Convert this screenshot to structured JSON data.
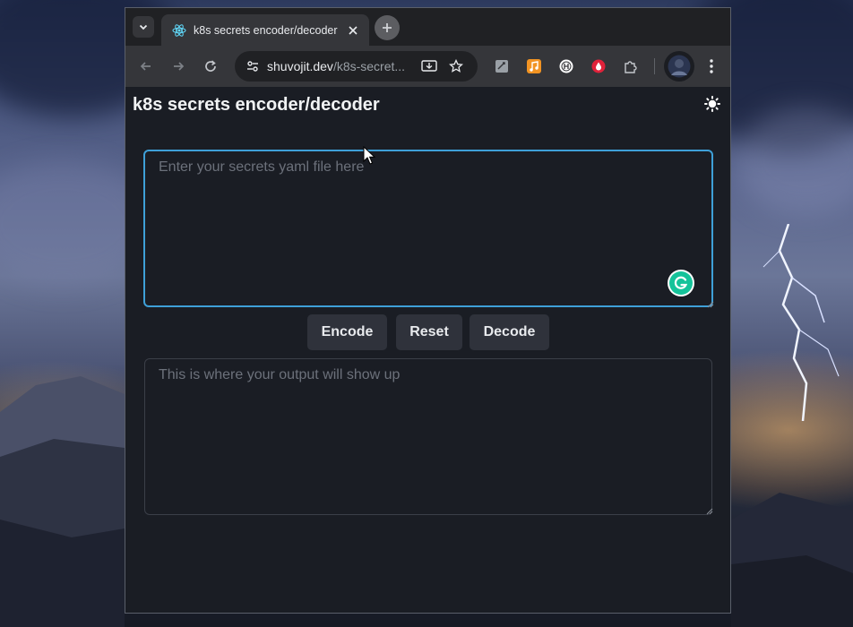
{
  "browser": {
    "tab": {
      "title": "k8s secrets encoder/decoder"
    },
    "address_bar": {
      "domain": "shuvojit.dev",
      "path": "/k8s-secret..."
    },
    "icons": {
      "tab_list": "chevron-down-icon",
      "tab_favicon": "react-icon",
      "tab_close": "close-icon",
      "new_tab": "plus-icon",
      "back": "arrow-left-icon",
      "forward": "arrow-right-icon",
      "reload": "reload-icon",
      "site_info": "tune-icon",
      "install": "install-app-icon",
      "bookmark": "star-icon",
      "extensions": [
        "notes-extension-icon",
        "music-extension-icon",
        "h-extension-icon",
        "drop-extension-icon",
        "puzzle-extensions-icon"
      ],
      "profile": "avatar",
      "menu": "kebab-menu-icon"
    }
  },
  "app": {
    "title": "k8s secrets encoder/decoder",
    "theme_toggle_icon": "sun-icon",
    "input": {
      "placeholder": "Enter your secrets yaml file here",
      "value": ""
    },
    "buttons": {
      "encode": "Encode",
      "reset": "Reset",
      "decode": "Decode"
    },
    "output": {
      "placeholder": "This is where your output will show up",
      "value": ""
    }
  },
  "colors": {
    "accent": "#3ea0d8",
    "page_bg": "#1a1d24",
    "button_bg": "#2f323b",
    "grammarly": "#15c39a"
  }
}
